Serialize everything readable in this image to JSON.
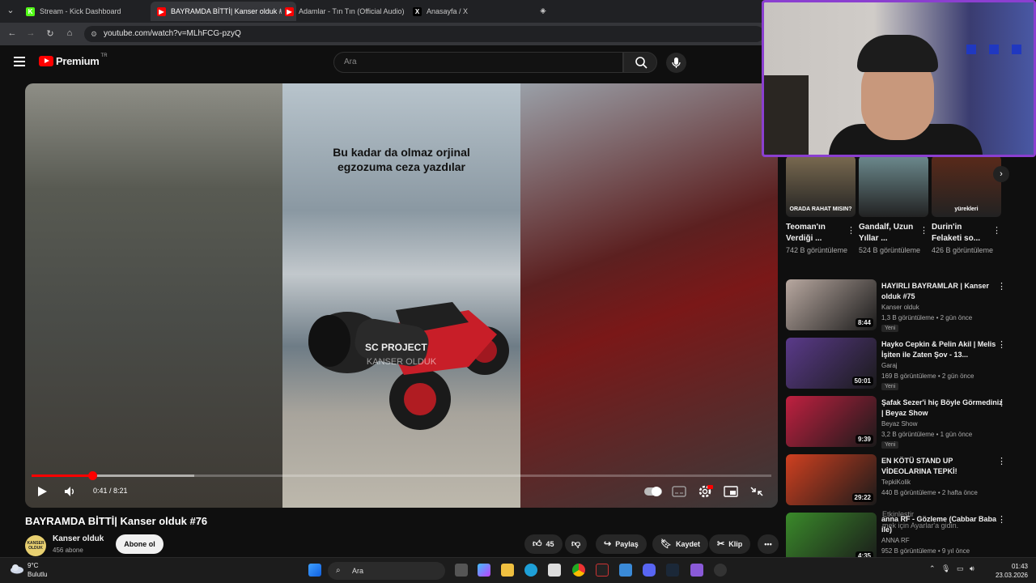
{
  "browser": {
    "tabs": [
      {
        "label": "Stream - Kick Dashboard",
        "fav": "K",
        "color": "#53fc18",
        "active": false
      },
      {
        "label": "BAYRAMDA BİTTİ| Kanser olduk #76",
        "fav": "▶",
        "color": "#ff0000",
        "active": true
      },
      {
        "label": "Adamlar - Tın Tın (Official Audio)",
        "fav": "▶",
        "color": "#ff0000",
        "active": false
      },
      {
        "label": "Anasayfa / X",
        "fav": "X",
        "color": "#000000",
        "active": false
      }
    ],
    "url": "youtube.com/watch?v=MLhFCG-pzyQ"
  },
  "header": {
    "logo_text": "Premium",
    "country": "TR",
    "search_placeholder": "Ara"
  },
  "player": {
    "caption": "Bu kadar da olmaz orjinal egzozuma ceza yazdılar",
    "watermark": "KANSER OLDUK",
    "plate": "SC PROJECT",
    "time": "0:41 / 8:21",
    "progress": 0.082
  },
  "video": {
    "title": "BAYRAMDA BİTTİ| Kanser olduk #76",
    "channel": "Kanser olduk",
    "channel_avatar_text": "KANSER OLDUK",
    "subs": "456 abone",
    "subscribe": "Abone ol",
    "likes": "45",
    "share": "Paylaş",
    "save": "Kaydet",
    "clip": "Klip"
  },
  "shorts": [
    {
      "title": "Teoman'ın Verdiği ...",
      "views": "742 B görüntüleme",
      "thumb": "ORADA RAHAT MISIN?",
      "color": "#7a6a50"
    },
    {
      "title": "Gandalf, Uzun Yıllar ...",
      "views": "524 B görüntüleme",
      "thumb": "",
      "color": "#6c8a8e"
    },
    {
      "title": "Durin'in Felaketi so...",
      "views": "426 B görüntüleme",
      "thumb": "yürekleri",
      "color": "#5a2a1a"
    }
  ],
  "recommended": [
    {
      "title": "HAYIRLI BAYRAMLAR | Kanser olduk #75",
      "channel": "Kanser olduk",
      "meta": "1,3 B görüntüleme • 2 gün önce",
      "badge": "Yeni",
      "duration": "8:44",
      "color": "#b8a8a0"
    },
    {
      "title": "Hayko Cepkin & Pelin Akil | Melis İşiten ile Zaten Şov - 13...",
      "channel": "Garaj",
      "meta": "169 B görüntüleme • 2 gün önce",
      "badge": "Yeni",
      "duration": "50:01",
      "color": "#5a3a8a"
    },
    {
      "title": "Şafak Sezer'i hiç Böyle Görmediniz | Beyaz Show",
      "channel": "Beyaz Show",
      "meta": "3,2 B görüntüleme • 1 gün önce",
      "badge": "Yeni",
      "duration": "9:39",
      "color": "#c02040"
    },
    {
      "title": "EN KÖTÜ STAND UP VİDEOLARINA TEPKİ!",
      "channel": "TepkiKolik",
      "meta": "440 B görüntüleme • 2 hafta önce",
      "badge": "",
      "duration": "29:22",
      "color": "#d04020"
    },
    {
      "title": "anna RF - Gözleme (Cabbar Baba ile)",
      "channel": "ANNA RF",
      "meta": "952 B görüntüleme • 9 yıl önce",
      "badge": "",
      "duration": "4:35",
      "color": "#3a8a2a"
    }
  ],
  "notice": {
    "line1": "Etkinleştir",
    "line2": "mek için Ayarlar'a gidin."
  },
  "taskbar": {
    "temp": "9°C",
    "weather": "Bulutlu",
    "search": "Ara",
    "time": "01:43",
    "date": "23.03.2026"
  }
}
